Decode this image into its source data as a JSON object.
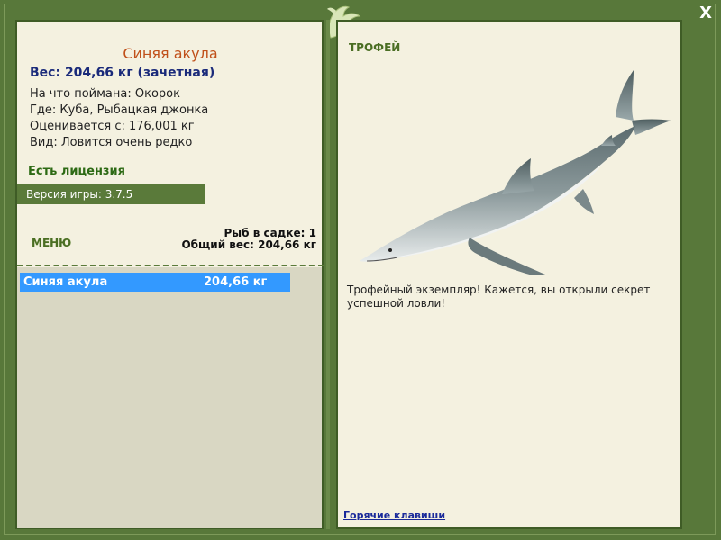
{
  "window": {
    "close_label": "X"
  },
  "fish": {
    "name": "Синяя акула",
    "weight_line": "Вес: 204,66 кг (зачетная)",
    "caught_on": "На что поймана: Окорок",
    "where": "Где: Куба, Рыбацкая джонка",
    "valued_from": "Оценивается с: 176,001 кг",
    "rarity": "Вид: Ловится очень редко"
  },
  "license_label": "Есть лицензия",
  "version_label": "Версия игры: 3.7.5",
  "menu_label": "МЕНЮ",
  "cage": {
    "count_line": "Рыб в садке: 1",
    "total_line": "Общий вес: 204,66 кг"
  },
  "catch_list": [
    {
      "name": "Синяя акула",
      "weight": "204,66 кг"
    }
  ],
  "trophy": {
    "label": "ТРОФЕЙ",
    "text": "Трофейный экземпляр! Кажется, вы открыли секрет успешной ловли!"
  },
  "hotkeys_label": "Горячие клавиши",
  "colors": {
    "frame_green": "#58783a",
    "panel_bg": "#f4f1e0",
    "fish_name_orange": "#c0501a",
    "weight_blue": "#1a2a7a",
    "selection_blue": "#3399ff"
  }
}
